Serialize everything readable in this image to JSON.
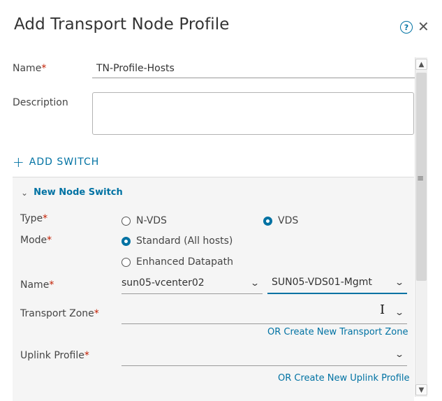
{
  "dialog": {
    "title": "Add Transport Node Profile"
  },
  "form": {
    "name_label": "Name",
    "name_value": "TN-Profile-Hosts",
    "description_label": "Description",
    "description_value": "",
    "required_mark": "*",
    "add_switch_label": "ADD SWITCH",
    "add_switch_plus": "+"
  },
  "switch": {
    "header": "New Node Switch",
    "type_label": "Type",
    "type_options": [
      "N-VDS",
      "VDS"
    ],
    "type_selected": "VDS",
    "mode_label": "Mode",
    "mode_options": [
      "Standard (All hosts)",
      "Enhanced Datapath"
    ],
    "mode_selected": "Standard (All hosts)",
    "name_label": "Name",
    "vcenter_value": "sun05-vcenter02",
    "vds_value": "SUN05-VDS01-Mgmt",
    "transport_zone_label": "Transport Zone",
    "transport_zone_value": "",
    "create_tz_link": "OR Create New Transport Zone",
    "uplink_profile_label": "Uplink Profile",
    "uplink_profile_value": "",
    "create_uplink_link": "OR Create New Uplink Profile"
  },
  "icons": {
    "help": "?",
    "close": "✕",
    "chevron_down": "⌄",
    "collapse": "⌄",
    "scroll_up": "▲",
    "scroll_down": "▼",
    "grip": "≡",
    "text_cursor": "I"
  },
  "colors": {
    "accent": "#0072a3",
    "required": "#c21d00"
  }
}
